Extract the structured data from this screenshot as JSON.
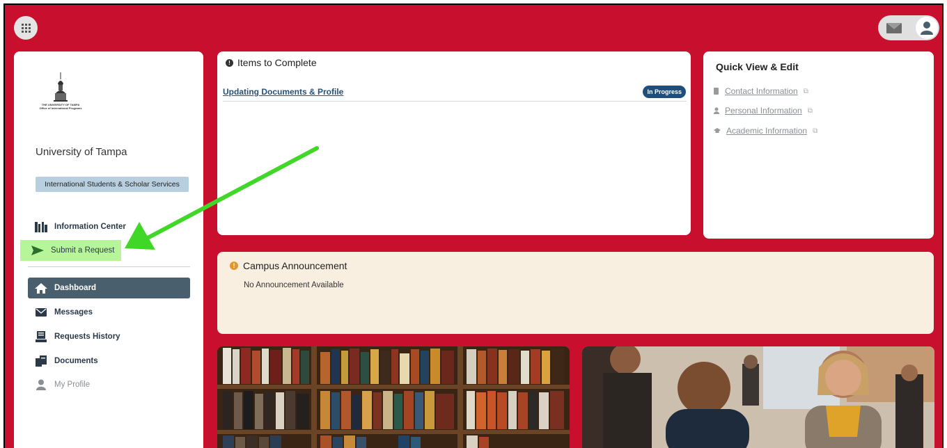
{
  "colors": {
    "brand_red": "#c8102e",
    "nav_active": "#4a5f6e",
    "badge_blue": "#1f4e7a",
    "highlight_green": "#b6f59a",
    "arrow_green": "#41d728",
    "announcement_bg": "#f9efe0"
  },
  "header": {
    "apps_icon": "grid-icon",
    "mail_icon": "envelope-icon",
    "profile_icon": "user-icon"
  },
  "sidebar": {
    "logo_text_line1": "THE UNIVERSITY OF TAMPA",
    "logo_text_line2": "Office of International Programs",
    "university": "University of Tampa",
    "department": "International Students & Scholar Services",
    "items": [
      {
        "label": "Information Center",
        "icon": "library-icon"
      },
      {
        "label": "Submit a Request",
        "icon": "send-icon"
      },
      {
        "label": "Dashboard",
        "icon": "home-icon"
      },
      {
        "label": "Messages",
        "icon": "envelope-icon"
      },
      {
        "label": "Requests History",
        "icon": "history-icon"
      },
      {
        "label": "Documents",
        "icon": "documents-icon"
      },
      {
        "label": "My Profile",
        "icon": "user-icon"
      }
    ]
  },
  "items_to_complete": {
    "title": "Items to Complete",
    "items": [
      {
        "label": "Updating Documents & Profile",
        "status": "In Progress"
      }
    ]
  },
  "quick_view": {
    "title": "Quick View & Edit",
    "links": [
      {
        "label": "Contact Information",
        "icon": "phone-icon"
      },
      {
        "label": "Personal Information",
        "icon": "person-icon"
      },
      {
        "label": "Academic Information",
        "icon": "graduation-cap-icon"
      }
    ]
  },
  "announcement": {
    "title": "Campus Announcement",
    "text": "No Announcement Available"
  }
}
